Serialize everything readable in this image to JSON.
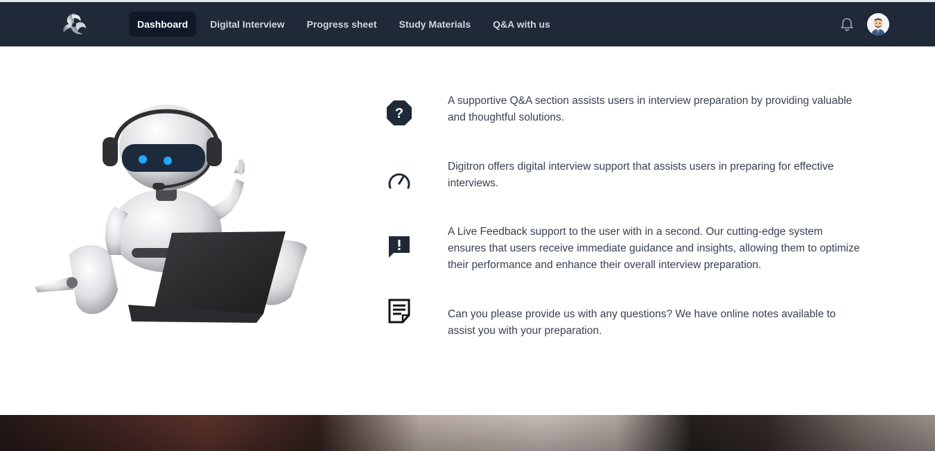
{
  "nav": {
    "items": [
      {
        "label": "Dashboard",
        "active": true
      },
      {
        "label": "Digital Interview",
        "active": false
      },
      {
        "label": "Progress sheet",
        "active": false
      },
      {
        "label": "Study Materials",
        "active": false
      },
      {
        "label": "Q&A with us",
        "active": false
      }
    ]
  },
  "icons": {
    "logo": "app-logo",
    "bell": "bell-icon",
    "avatar": "user-avatar"
  },
  "features": [
    {
      "icon": "question-octagon-icon",
      "text": "A supportive Q&A section assists users in interview preparation by providing valuable and thoughtful solutions."
    },
    {
      "icon": "speedometer-icon",
      "text": "Digitron offers digital interview support that assists users in preparing for effective interviews."
    },
    {
      "icon": "feedback-chat-icon",
      "text": "A Live Feedback support to the user with in a second. Our cutting-edge system ensures that users receive immediate guidance and insights, allowing them to optimize their performance and enhance their overall interview preparation."
    },
    {
      "icon": "notes-icon",
      "text": "Can you please provide us with any questions? We have online notes available to assist you with your preparation."
    }
  ],
  "colors": {
    "navbar": "#1f2937",
    "active_nav": "#111827",
    "text": "#374151",
    "icon": "#1f2937"
  }
}
